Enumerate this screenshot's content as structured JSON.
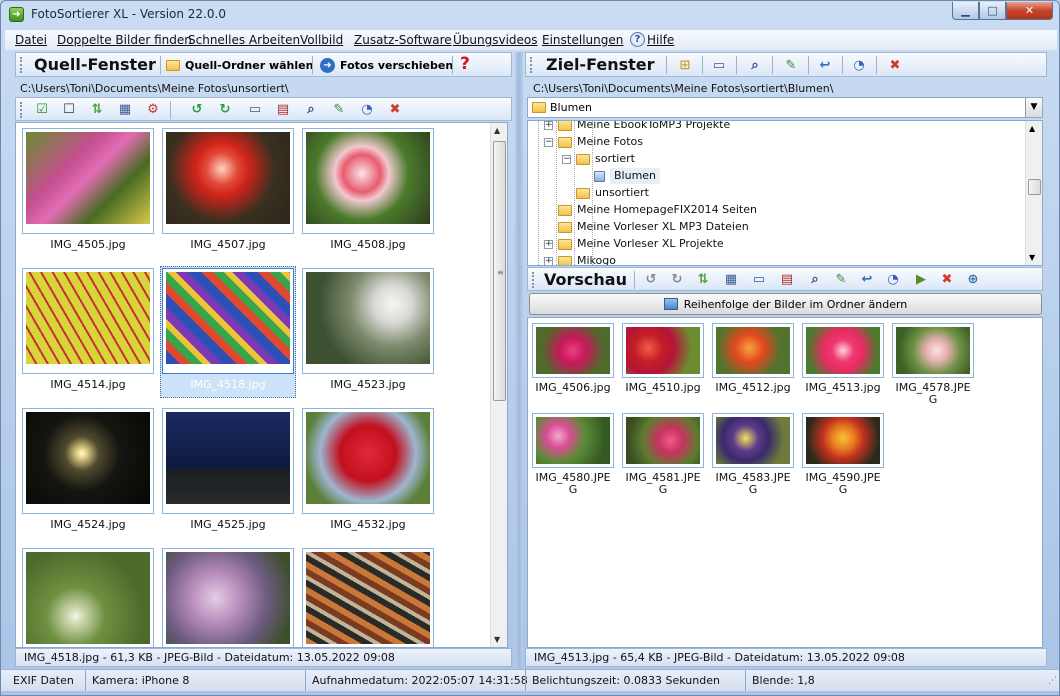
{
  "window": {
    "title": "FotoSortierer XL - Version 22.0.0"
  },
  "menu": [
    {
      "label": "Datei"
    },
    {
      "label": "Doppelte Bilder finden"
    },
    {
      "label": "Schnelles Arbeiten"
    },
    {
      "label": "Vollbild"
    },
    {
      "label": "Zusatz-Software"
    },
    {
      "label": "Übungsvideos"
    },
    {
      "label": "Einstellungen"
    },
    {
      "label": "Hilfe"
    }
  ],
  "source": {
    "title": "Quell-Fenster",
    "choose_folder_label": "Quell-Ordner wählen",
    "move_label": "Fotos verschieben",
    "path": "C:\\Users\\Toni\\Documents\\Meine Fotos\\unsortiert\\",
    "thumbs": [
      {
        "name": "IMG_4505.jpg",
        "bg": "linear-gradient(135deg,#6a8d2f,#c2508f 35%,#e36cb3 50%,#496b21 70%,#d7c84a)"
      },
      {
        "name": "IMG_4507.jpg",
        "bg": "radial-gradient(circle at 45% 40%,#ffd2c0 0,#e24a3a 18%,#d2231b 30%,#39301f 60%,#2a261d)"
      },
      {
        "name": "IMG_4508.jpg",
        "bg": "radial-gradient(circle at 45% 45%,#fbe2e6 0,#e85c6f 22%,#f0c8cf 32%,#4b7a2b 55%,#2c3c1f)"
      },
      {
        "name": "IMG_4514.jpg",
        "bg": "repeating-linear-gradient(60deg,#d7d53a 0 8px,#c63131 8px 10px),linear-gradient(#c9c33a,#8aa233)"
      },
      {
        "name": "IMG_4518.jpg",
        "bg": "repeating-linear-gradient(45deg,#2f4fb8 0 10px,#e0492f 10px 18px,#36a64b 18px 26px,#f1c13a 26px 32px,#7a3ab3 32px 40px)"
      },
      {
        "name": "IMG_4523.jpg",
        "bg": "radial-gradient(circle at 70% 35%,#f6f6f4 0,#d8d8d3 18%,#7e8b6d 40%,#3d5031 70%),#3b4d2d"
      },
      {
        "name": "IMG_4524.jpg",
        "bg": "radial-gradient(circle at 45% 45%,#fffbe8 0,#e9d68a 5%,#514b2e 20%,#141410 45%,#070705)"
      },
      {
        "name": "IMG_4525.jpg",
        "bg": "linear-gradient(#1b2b62,#0e1a40 60%,#1a1d22 62%,#272b2c)"
      },
      {
        "name": "IMG_4532.jpg",
        "bg": "radial-gradient(circle at 50% 45%,#e3283a 0,#c2101f 35%,#9db6d0 60%,#5c7f3a 80%)"
      },
      {
        "name": "",
        "bg": "radial-gradient(circle at 40% 70%,#f4f4ee 0,#cfd8b2 8%,#6f9040 30%,#4c6a2c 70%)"
      },
      {
        "name": "",
        "bg": "radial-gradient(circle at 40% 50%,#e6cde6 0,#b48ab8 30%,#6b5a7e 60%,#3c4f2a 90%)"
      },
      {
        "name": "",
        "bg": "repeating-linear-gradient(30deg,#c9783a 0 6px,#2a2a26 6px 12px,#c0b59a 12px 16px,#7a3b20 16px 22px)"
      }
    ],
    "status": "IMG_4518.jpg - 61,3 KB - JPEG-Bild - Dateidatum: 13.05.2022 09:08"
  },
  "target": {
    "title": "Ziel-Fenster",
    "path": "C:\\Users\\Toni\\Documents\\Meine Fotos\\sortiert\\Blumen\\",
    "combo_value": "Blumen",
    "tree": [
      {
        "label": "Meine EbookToMP3 Projekte",
        "level": 2,
        "exp": "+"
      },
      {
        "label": "Meine Fotos",
        "level": 2,
        "exp": "-"
      },
      {
        "label": "sortiert",
        "level": 3,
        "exp": "-"
      },
      {
        "label": "Blumen",
        "level": 4,
        "exp": ""
      },
      {
        "label": "unsortiert",
        "level": 3,
        "exp": ""
      },
      {
        "label": "Meine HomepageFIX2014 Seiten",
        "level": 2,
        "exp": ""
      },
      {
        "label": "Meine Vorleser XL MP3 Dateien",
        "level": 2,
        "exp": ""
      },
      {
        "label": "Meine Vorleser XL Projekte",
        "level": 2,
        "exp": "+"
      },
      {
        "label": "Mikogo",
        "level": 2,
        "exp": "+"
      }
    ]
  },
  "preview": {
    "title": "Vorschau",
    "reorder_label": "Reihenfolge der Bilder im Ordner ändern",
    "thumbs": [
      {
        "name": "IMG_4506.jpg",
        "bg": "radial-gradient(circle at 50% 50%,#ec3f7e 0,#c6185a 30%,#4f6a2a 70%)"
      },
      {
        "name": "IMG_4510.jpg",
        "bg": "radial-gradient(circle at 30% 45%,#f25a4b 0,#c21d25 25%,#b5143a 45%,#6c8d2f 75%)"
      },
      {
        "name": "IMG_4512.jpg",
        "bg": "radial-gradient(circle at 45% 45%,#f7a33a 0,#e2471f 30%,#52742f 65%)"
      },
      {
        "name": "IMG_4513.jpg",
        "bg": "radial-gradient(circle at 50% 50%,#ffd1de 0,#ee3a6f 25%,#e82b61 45%,#4d7a2e 80%)"
      },
      {
        "name": "IMG_4578.JPEG",
        "bg": "radial-gradient(circle at 55% 50%,#fbe2e2 0,#e8b1b1 22%,#6d9145 50%,#3e6126 80%)"
      },
      {
        "name": "IMG_4580.JPEG",
        "bg": "radial-gradient(circle at 30% 40%,#f4a8cf 0,#d94e95 20%,#5b8b35 45%,#355a21 80%)"
      },
      {
        "name": "IMG_4581.JPEG",
        "bg": "radial-gradient(circle at 60% 50%,#ef5b8a 0,#c8325f 25%,#5d7c2f 55%,#3a4d21 85%)"
      },
      {
        "name": "IMG_4583.JPEG",
        "bg": "radial-gradient(circle at 40% 45%,#f5e45a 0,#5c3c8a 25%,#3a2a6a 45%,#6d7b3d 75%)"
      },
      {
        "name": "IMG_4590.JPEG",
        "bg": "radial-gradient(circle at 50% 45%,#fbc23a 0,#e77c1f 25%,#c2321f 45%,#2a2a1c 80%)"
      }
    ],
    "status": "IMG_4513.jpg - 65,4 KB - JPEG-Bild - Dateidatum: 13.05.2022 09:08"
  },
  "exif": {
    "label": "EXIF Daten",
    "camera": "Kamera: iPhone 8",
    "date": "Aufnahmedatum: 2022:05:07 14:31:58",
    "exposure": "Belichtungszeit: 0.0833 Sekunden",
    "aperture": "Blende: 1,8"
  },
  "colors": {
    "accent": "#2f6fbf",
    "selection": "#cce2f8"
  }
}
